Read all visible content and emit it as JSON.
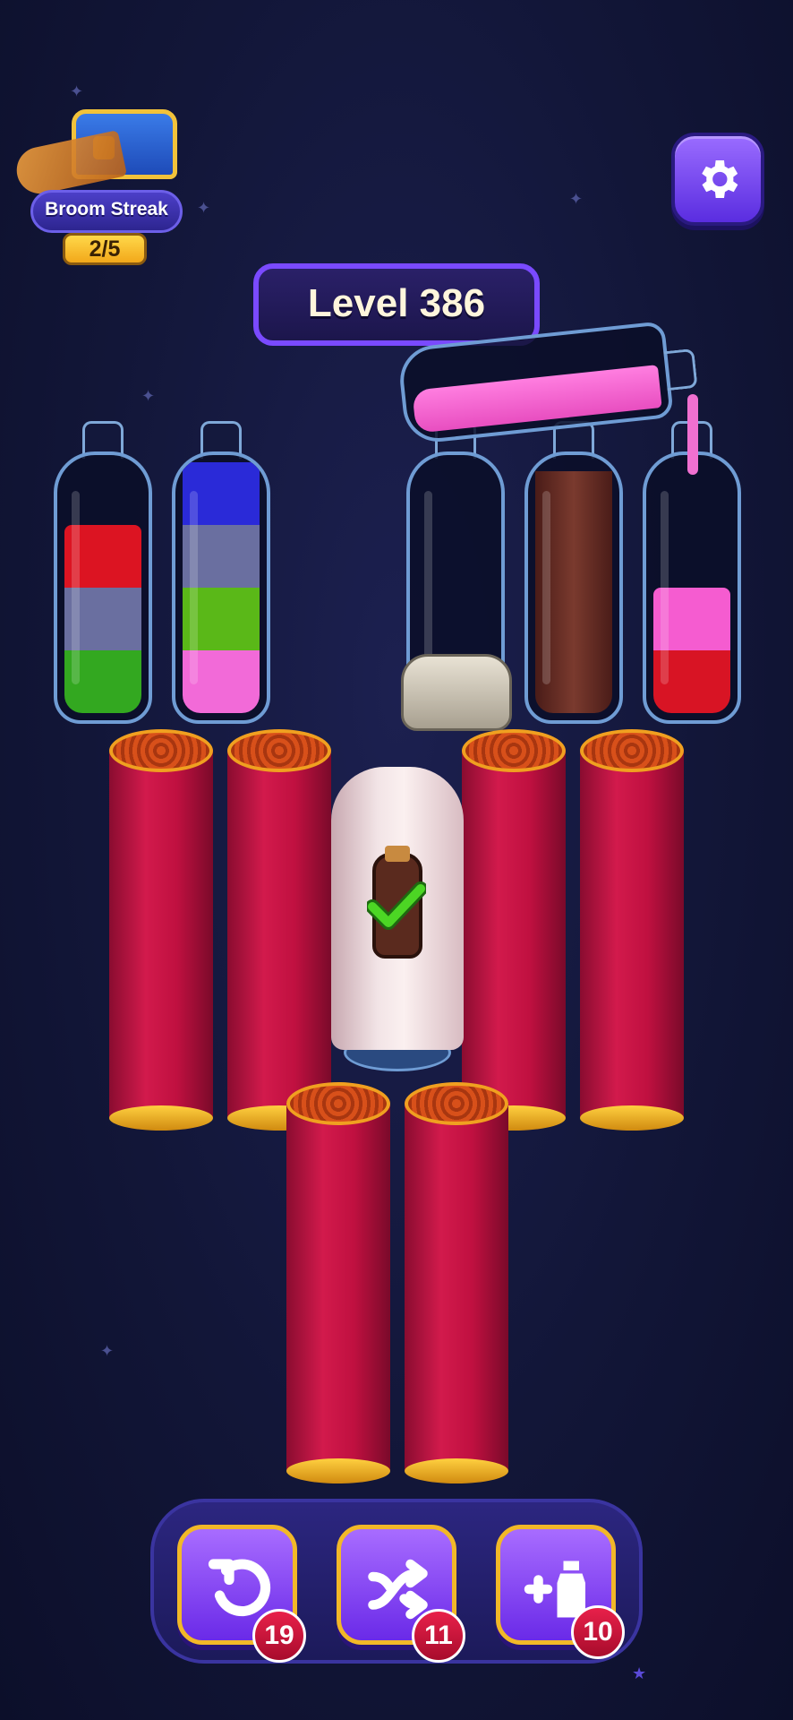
{
  "streak": {
    "title": "Broom Streak",
    "progress": "2/5"
  },
  "level": {
    "label": "Level 386"
  },
  "bottles": [
    {
      "layers": [
        "#33a820",
        "#6a6fa0",
        "#dc1422"
      ],
      "colors_note": "green, gray-blue, red"
    },
    {
      "layers": [
        "#f26ad8",
        "#5ab818",
        "#6a6fa0",
        "#2a2ad8"
      ]
    },
    {
      "layers": [
        "#8acd2a"
      ]
    },
    {
      "layers": [
        "#6a2a22"
      ]
    },
    {
      "layers": [
        "#d81424",
        "#f55cd0"
      ]
    }
  ],
  "pouring_bottle": {
    "color": "#f26ad8"
  },
  "boosters": {
    "undo": {
      "icon": "undo-icon",
      "count": "19"
    },
    "shuffle": {
      "icon": "shuffle-icon",
      "count": "11"
    },
    "add_bottle": {
      "icon": "add-bottle-icon",
      "count": "10"
    }
  },
  "settings": {
    "icon": "gear-icon"
  }
}
